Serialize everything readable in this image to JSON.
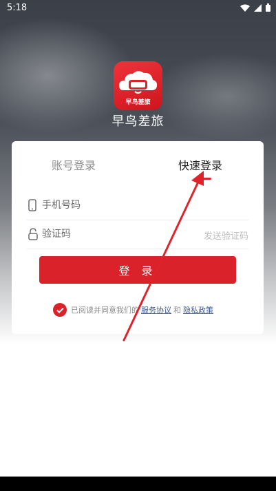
{
  "status_bar": {
    "time": "5:18"
  },
  "app": {
    "logo_text": "早鸟差旅",
    "name": "早鸟差旅"
  },
  "tabs": {
    "account": "账号登录",
    "quick": "快速登录"
  },
  "phone_field": {
    "placeholder": "手机号码",
    "value": ""
  },
  "code_field": {
    "placeholder": "验证码",
    "value": ""
  },
  "send_code": "发送验证码",
  "login_button": "登 录",
  "agreement": {
    "prefix": "已阅读并同意我们的",
    "service": "服务协议",
    "and": "和",
    "privacy": "隐私政策",
    "checked": true
  },
  "colors": {
    "accent": "#d9222a",
    "link": "#3b5b9a"
  }
}
